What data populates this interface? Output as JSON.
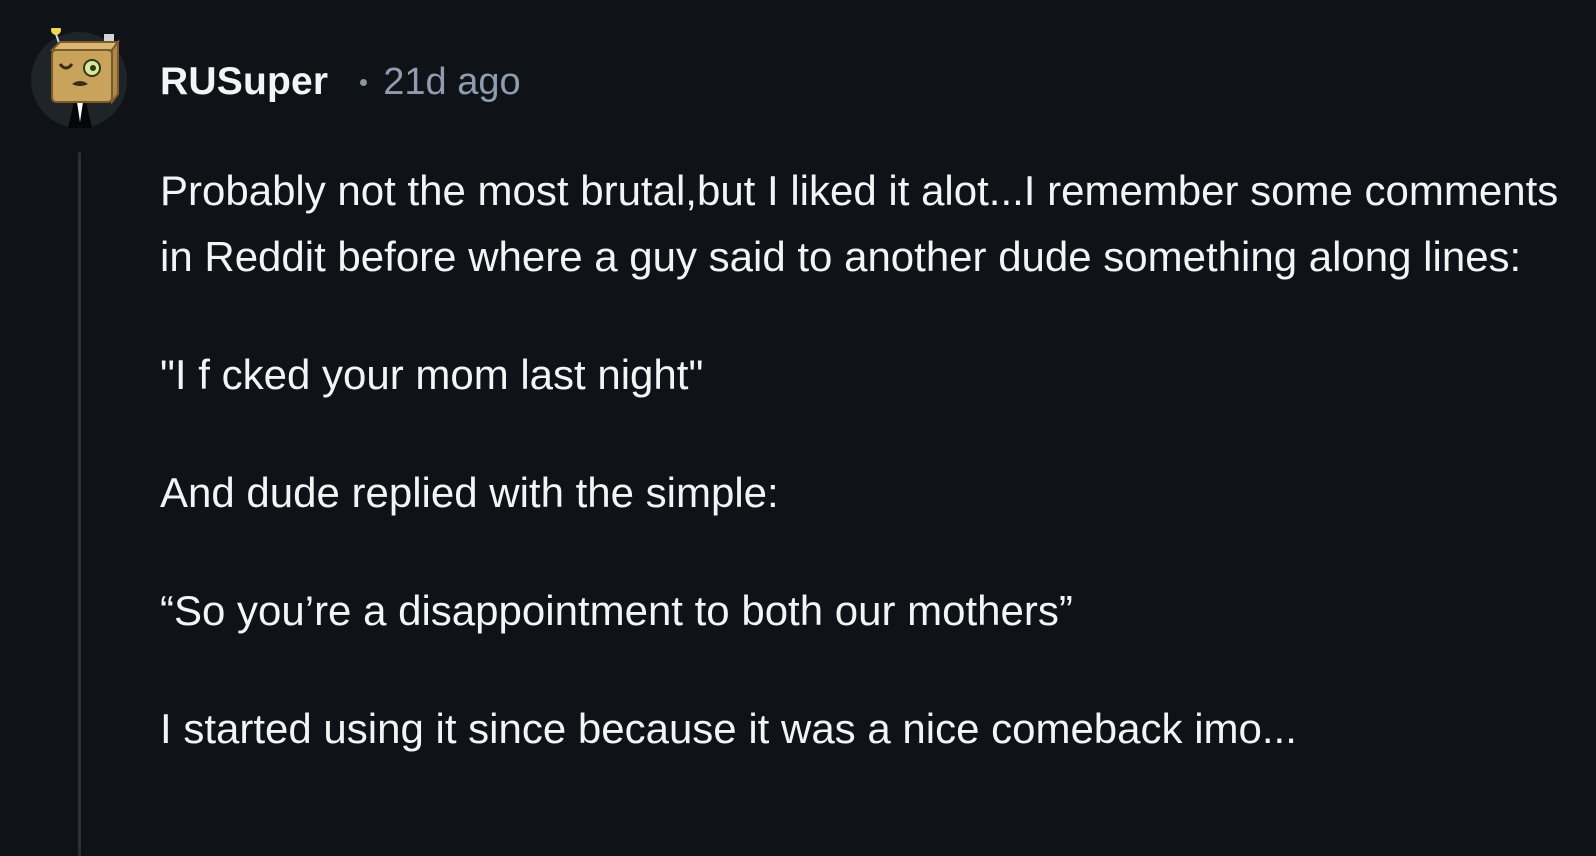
{
  "comment": {
    "author": "RUSuper",
    "time_ago": "21d ago",
    "paragraphs": [
      "Probably not the most brutal,but I liked it alot...I remember some comments in Reddit before where a guy said to another dude something along lines:",
      "\"I f  cked your mom last night\"",
      "And dude replied with the simple:",
      "“So you’re a disappointment to both our mothers”",
      "I started using it since because it was a nice comeback imo..."
    ]
  },
  "colors": {
    "background": "#0f1216",
    "text": "#f2f4f5",
    "meta": "#8f9cb0",
    "thread_line": "#2a3036"
  },
  "icons": {
    "avatar": "snoo-box-head-avatar",
    "separator": "dot-separator"
  }
}
